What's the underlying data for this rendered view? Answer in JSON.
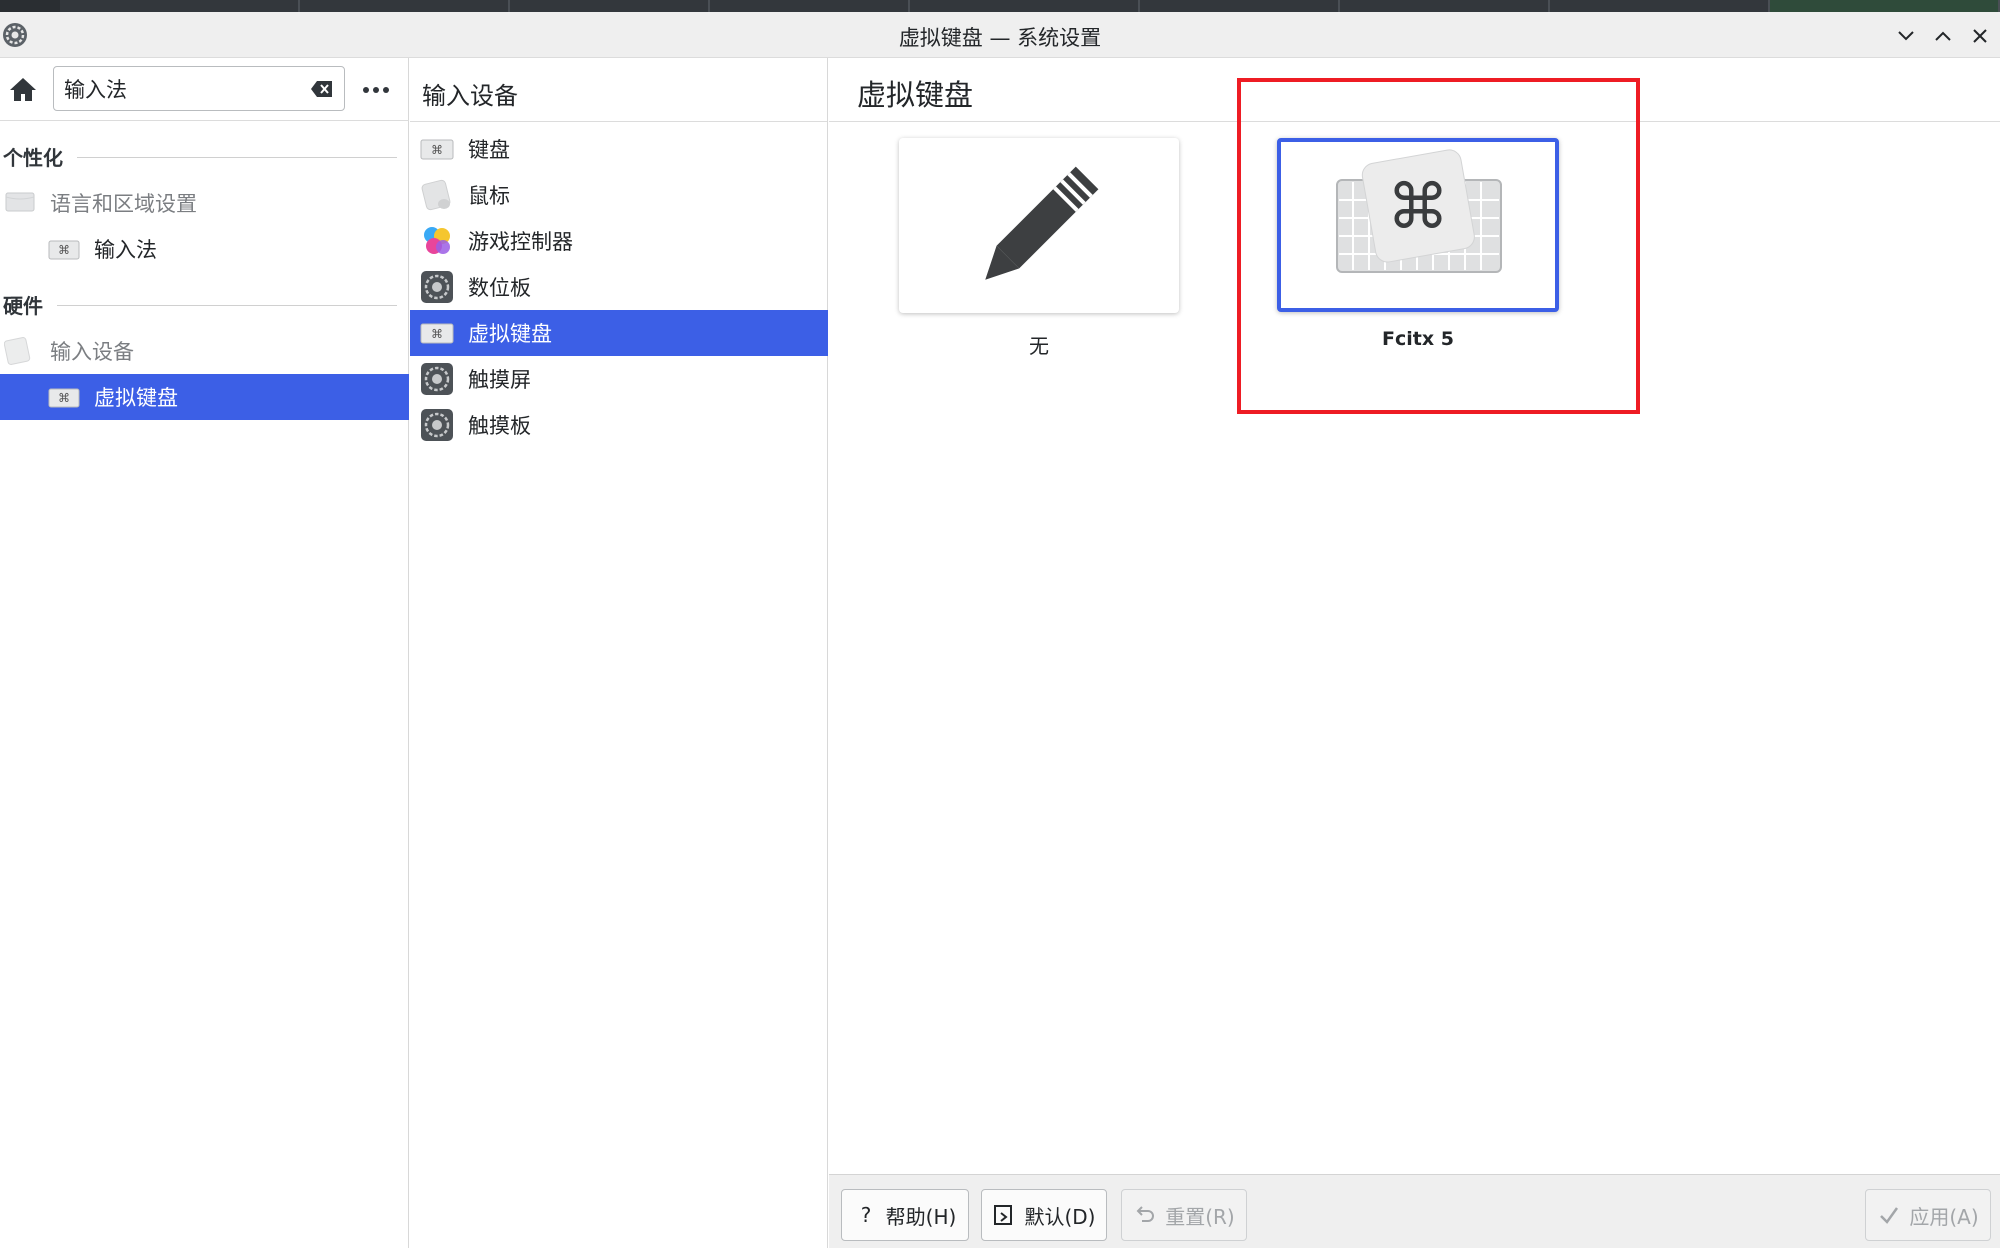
{
  "window": {
    "title": "虚拟键盘 — 系统设置"
  },
  "sidebar": {
    "search": {
      "value": "输入法",
      "placeholder": ""
    },
    "sections": [
      {
        "label": "个性化"
      },
      {
        "label": "硬件"
      }
    ],
    "items": [
      {
        "label": "语言和区域设置",
        "icon": "flag-icon"
      },
      {
        "label": "输入法",
        "icon": "keyboard-icon"
      },
      {
        "label": "输入设备",
        "icon": "input-devices-icon"
      },
      {
        "label": "虚拟键盘",
        "icon": "keyboard-icon"
      }
    ]
  },
  "middle": {
    "title": "输入设备",
    "items": [
      {
        "label": "键盘",
        "icon": "keyboard-icon"
      },
      {
        "label": "鼠标",
        "icon": "mouse-icon"
      },
      {
        "label": "游戏控制器",
        "icon": "game-controller-icon"
      },
      {
        "label": "数位板",
        "icon": "tablet-icon"
      },
      {
        "label": "虚拟键盘",
        "icon": "keyboard-icon"
      },
      {
        "label": "触摸屏",
        "icon": "touchscreen-icon"
      },
      {
        "label": "触摸板",
        "icon": "touchpad-icon"
      }
    ]
  },
  "main": {
    "title": "虚拟键盘",
    "options": [
      {
        "label": "无",
        "icon": "pencil-icon"
      },
      {
        "label": "Fcitx 5",
        "icon": "fcitx-keyboard-icon"
      }
    ]
  },
  "footer": {
    "help": "帮助(H)",
    "defaults": "默认(D)",
    "reset": "重置(R)",
    "apply": "应用(A)"
  },
  "colors": {
    "accent": "#3c5fe6",
    "highlight": "#ee1c24"
  }
}
